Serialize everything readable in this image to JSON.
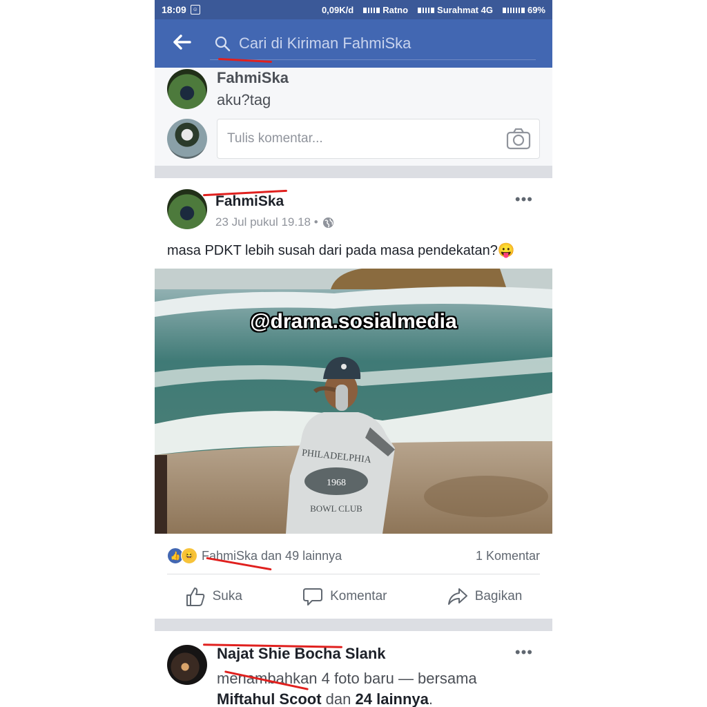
{
  "status_bar": {
    "time": "18:09",
    "speed": "0,09K/d",
    "carrier1": "Ratno",
    "carrier2": "Surahmat 4G",
    "battery": "69%"
  },
  "search": {
    "placeholder": "Cari di Kiriman FahmiSka"
  },
  "top_comment": {
    "author": "FahmiSka",
    "text": "aku?tag"
  },
  "comment_input": {
    "placeholder": "Tulis komentar..."
  },
  "post": {
    "author": "FahmiSka",
    "meta": "23 Jul pukul 19.18 •",
    "text": "masa PDKT lebih susah dari pada masa pendekatan?😛",
    "photo_watermark": "@drama.sosialmedia",
    "photo_shirt_text": "PHILADELPHIA 1968 BOWL CLUB",
    "reactions_text": "FahmiSka dan 49 lainnya",
    "comments_count": "1 Komentar",
    "actions": {
      "like": "Suka",
      "comment": "Komentar",
      "share": "Bagikan"
    }
  },
  "next_post": {
    "author": "Najat Shie Bocha Slank",
    "text_start": "menambahkan 4 foto baru — bersama",
    "tagged": "Miftahul Scoot",
    "and": "dan",
    "others": "24 lainnya",
    "end": "."
  },
  "colors": {
    "facebook_blue": "#4267b2",
    "status_blue": "#3b5998",
    "annotation_red": "#e0201e"
  },
  "icons": [
    "back-arrow-icon",
    "search-icon",
    "camera-icon",
    "globe-icon",
    "more-icon",
    "like-reaction-icon",
    "haha-reaction-icon",
    "thumbs-up-icon",
    "comment-icon",
    "share-icon"
  ]
}
